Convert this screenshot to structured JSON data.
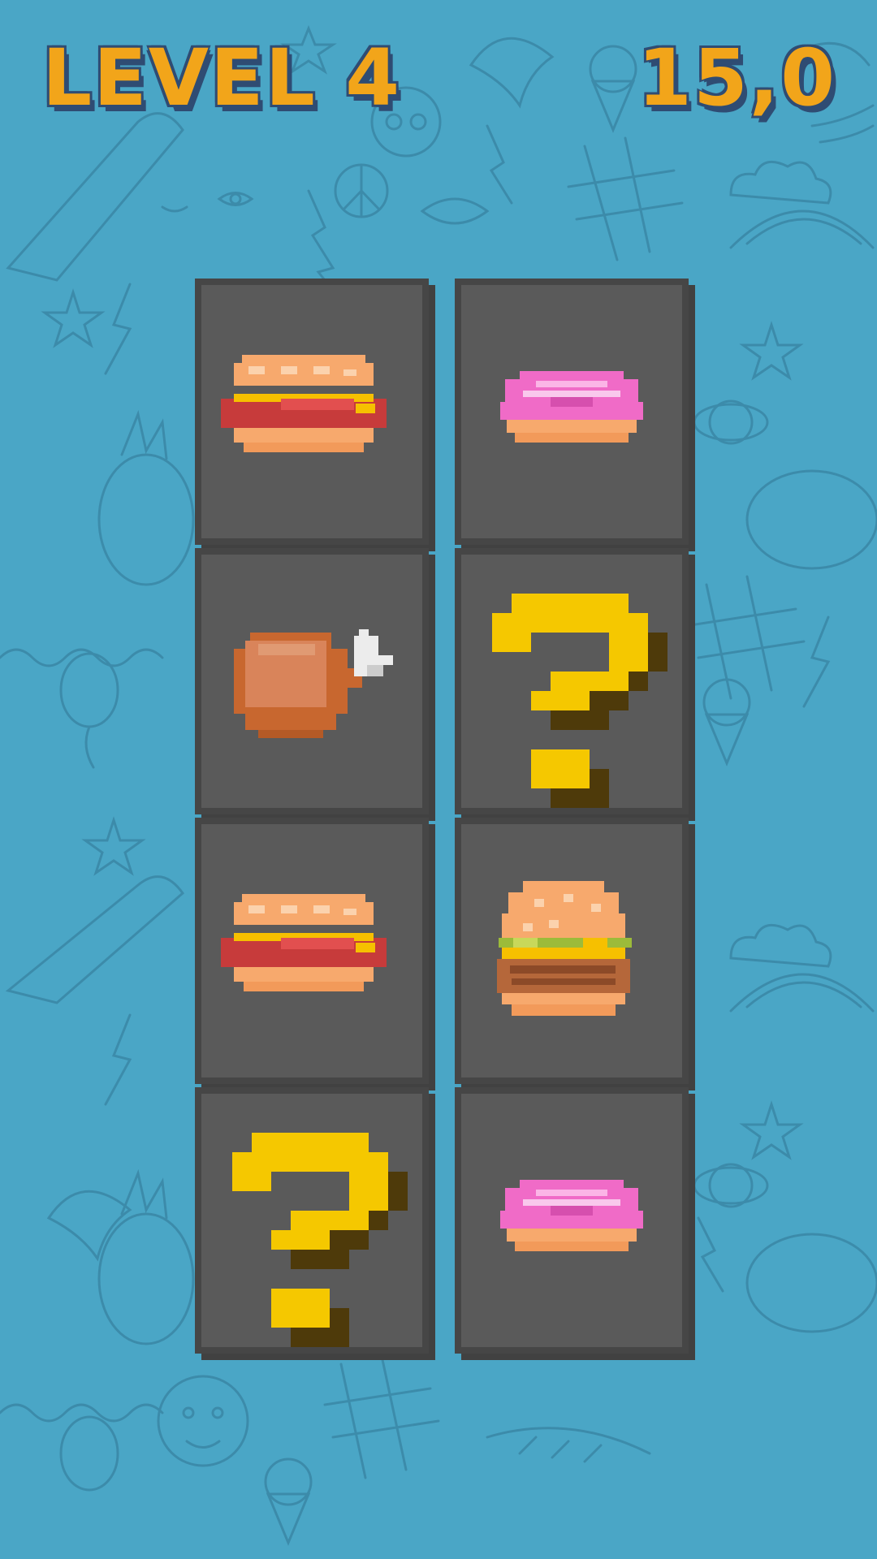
{
  "hud": {
    "level_label": "LEVEL 4",
    "timer": "15,0"
  },
  "colors": {
    "background": "#4aa6c6",
    "card_face": "#5a5a5a",
    "card_border": "#464646",
    "hud_text": "#f2a51a",
    "hud_outline": "#2f4c73"
  },
  "cards": [
    {
      "row": 1,
      "col": 1,
      "state": "revealed",
      "icon": "hotdog-icon"
    },
    {
      "row": 1,
      "col": 2,
      "state": "revealed",
      "icon": "donut-icon"
    },
    {
      "row": 2,
      "col": 1,
      "state": "revealed",
      "icon": "chicken-drumstick-icon"
    },
    {
      "row": 2,
      "col": 2,
      "state": "hidden",
      "icon": "question-mark-icon"
    },
    {
      "row": 3,
      "col": 1,
      "state": "revealed",
      "icon": "hotdog-icon"
    },
    {
      "row": 3,
      "col": 2,
      "state": "revealed",
      "icon": "burger-icon"
    },
    {
      "row": 4,
      "col": 1,
      "state": "hidden",
      "icon": "question-mark-icon"
    },
    {
      "row": 4,
      "col": 2,
      "state": "revealed",
      "icon": "donut-icon"
    }
  ]
}
